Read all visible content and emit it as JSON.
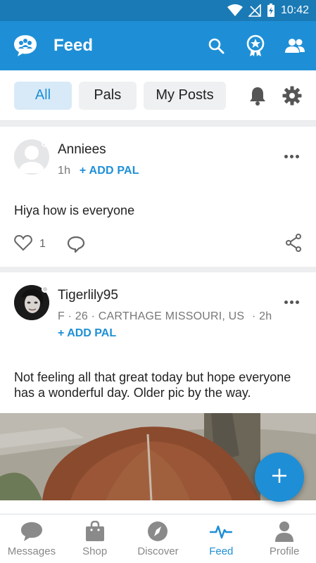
{
  "status_bar": {
    "time": "10:42"
  },
  "appbar": {
    "title": "Feed"
  },
  "tabs": [
    {
      "label": "All",
      "active": true
    },
    {
      "label": "Pals",
      "active": false
    },
    {
      "label": "My Posts",
      "active": false
    }
  ],
  "posts": [
    {
      "username": "Anniees",
      "time": "1h",
      "add_pal": "+ ADD PAL",
      "text": "Hiya how is everyone",
      "likes": "1"
    },
    {
      "username": "Tigerlily95",
      "details": "F · 26 · CARTHAGE MISSOURI, US",
      "time": "· 2h",
      "add_pal": "+ ADD PAL",
      "text": "Not feeling all that great today but hope everyone has a wonderful day. Older pic by the way."
    }
  ],
  "bottom_nav": [
    {
      "label": "Messages",
      "icon": "chat-bubble-icon",
      "active": false
    },
    {
      "label": "Shop",
      "icon": "shopping-bag-icon",
      "active": false
    },
    {
      "label": "Discover",
      "icon": "compass-icon",
      "active": false
    },
    {
      "label": "Feed",
      "icon": "pulse-icon",
      "active": true
    },
    {
      "label": "Profile",
      "icon": "person-icon",
      "active": false
    }
  ],
  "colors": {
    "primary": "#1e8fd6",
    "statusbar": "#1a7ab6",
    "inactive": "#888888"
  }
}
